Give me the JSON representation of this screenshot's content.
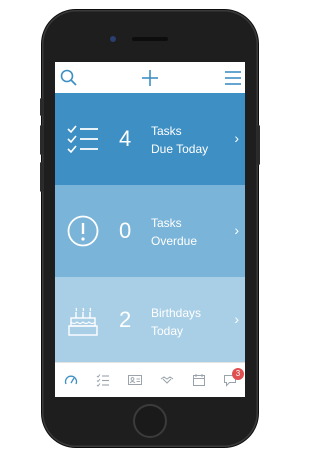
{
  "topbar": {
    "icons": [
      "search-icon",
      "plus-icon",
      "menu-icon"
    ]
  },
  "tiles": [
    {
      "count": "4",
      "line1": "Tasks",
      "line2": "Due Today",
      "icon": "checklist-icon",
      "color": "#3e8fc4"
    },
    {
      "count": "0",
      "line1": "Tasks",
      "line2": "Overdue",
      "icon": "alert-icon",
      "color": "#7ab4d8"
    },
    {
      "count": "2",
      "line1": "Birthdays",
      "line2": "Today",
      "icon": "cake-icon",
      "color": "#a9cfe6"
    }
  ],
  "tabbar": {
    "icons": [
      "dashboard-icon",
      "tasks-icon",
      "contacts-icon",
      "handshake-icon",
      "calendar-icon",
      "messages-icon"
    ],
    "badge": "3"
  },
  "colors": {
    "accent": "#3e8fc4"
  }
}
